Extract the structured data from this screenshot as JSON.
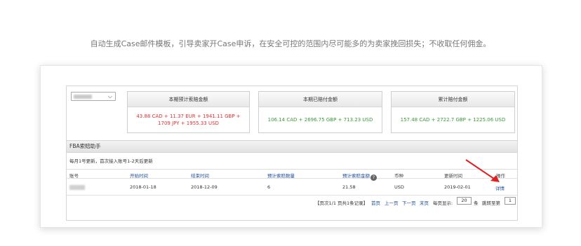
{
  "caption": "自动生成Case邮件模板，引导卖家开Case申诉，在安全可控的范围内尽可能多的为卖家挽回损失；不收取任何佣金。",
  "stats": [
    {
      "title": "本期预计索赔金额",
      "value": "43.88 CAD + 11.37 EUR + 1941.11 GBP + 1709 JPY + 1955.33 USD",
      "color": "#e23030"
    },
    {
      "title": "本期已赔付金额",
      "value": "106.14 CAD + 2696.75 GBP + 713.23 USD",
      "color": "#3a9a3a"
    },
    {
      "title": "累计赔付金额",
      "value": "157.48 CAD + 2722.7 GBP + 1225.06 USD",
      "color": "#3a9a3a"
    }
  ],
  "section": {
    "title": "FBA索赔助手",
    "notice": "每月1号更新，首次接入账号1-2天后更新"
  },
  "table": {
    "headers": [
      "账号",
      "开始时间",
      "结束时间",
      "预计索赔数量",
      "预计索赔金额",
      "币种",
      "更新时间",
      "操作"
    ],
    "help_icon": "?",
    "rows": [
      {
        "account": "",
        "start": "2018-01-18",
        "end": "2018-12-09",
        "count": "6",
        "amount": "21.58",
        "currency": "USD",
        "updated": "2019-02-01",
        "action": "详情"
      }
    ]
  },
  "pager": {
    "info": "【页次1/1  页共1条记录】",
    "first": "首页",
    "prev": "上一页",
    "next": "下一页",
    "last": "末页",
    "per_page_label": "每页显示:",
    "per_page": "20",
    "unit": "条",
    "jump_label": "跳转至第",
    "jump_page": "1"
  },
  "icons": {
    "dropdown": "chevron-down-icon",
    "help": "question-circle-icon",
    "annotation": "red-arrow-icon"
  },
  "colors": {
    "link": "#1f4e9a",
    "negative": "#e23030",
    "positive": "#3a9a3a",
    "arrow": "#e02020"
  }
}
